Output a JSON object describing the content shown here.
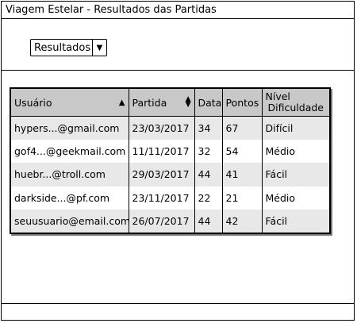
{
  "window": {
    "title": "Viagem Estelar - Resultados das Partidas"
  },
  "filter": {
    "selected": "Resultados",
    "arrow_icon": "triangle-down-icon"
  },
  "table": {
    "headers": {
      "usuario": "Usuário",
      "partida": "Partida",
      "data": "Data",
      "pontos": "Pontos",
      "nivel_line1": "Nível",
      "nivel_line2": "Dificuldade"
    },
    "rows": [
      {
        "usuario": "hypers...@gmail.com",
        "partida": "23/03/2017",
        "data": "34",
        "pontos": "67",
        "nivel": "Difícil"
      },
      {
        "usuario": "gof4...@geekmail.com",
        "partida": "11/11/2017",
        "data": "32",
        "pontos": "54",
        "nivel": "Médio"
      },
      {
        "usuario": "huebr...@troll.com",
        "partida": "29/03/2017",
        "data": "44",
        "pontos": "41",
        "nivel": "Fácil"
      },
      {
        "usuario": "darkside...@pf.com",
        "partida": "23/11/2017",
        "data": "22",
        "pontos": "21",
        "nivel": "Médio"
      },
      {
        "usuario": "seuusuario@email.com",
        "partida": "26/07/2017",
        "data": "44",
        "pontos": "42",
        "nivel": "Fácil"
      }
    ]
  }
}
